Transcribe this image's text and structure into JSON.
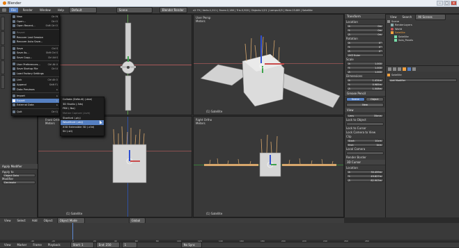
{
  "window": {
    "title": "Blender"
  },
  "infobar": {
    "menus": [
      "File",
      "Render",
      "Window",
      "Help"
    ],
    "layout": "Default",
    "scene": "Scene",
    "engine": "Blender Render",
    "stats": "v2.79 | Verts:1,211 | Faces:2,180 | Tris:3,920 | Objects:1/21 | Lamps:0/0 | Mem:23.8M | Satellite"
  },
  "file_menu": {
    "items": [
      {
        "label": "New",
        "shortcut": "Ctrl N",
        "icon": "new-file-icon",
        "state": "normal"
      },
      {
        "label": "Open...",
        "shortcut": "Ctrl O",
        "icon": "folder-open-icon",
        "state": "normal"
      },
      {
        "label": "Open Recent...",
        "shortcut": "Shift Ctrl O",
        "icon": "recent-icon",
        "state": "normal"
      },
      {
        "label": "Revert",
        "shortcut": "",
        "icon": "revert-icon",
        "state": "dim"
      },
      {
        "label": "Recover Last Session",
        "shortcut": "",
        "icon": "recover-icon",
        "state": "normal"
      },
      {
        "label": "Recover Auto Save...",
        "shortcut": "",
        "icon": "recover-auto-icon",
        "state": "normal"
      },
      {
        "label": "Save",
        "shortcut": "Ctrl S",
        "icon": "save-icon",
        "state": "normal"
      },
      {
        "label": "Save As...",
        "shortcut": "Shift Ctrl S",
        "icon": "save-as-icon",
        "state": "normal"
      },
      {
        "label": "Save Copy...",
        "shortcut": "Ctrl Alt S",
        "icon": "save-copy-icon",
        "state": "normal"
      },
      {
        "label": "User Preferences...",
        "shortcut": "Ctrl Alt U",
        "icon": "preferences-icon",
        "state": "normal"
      },
      {
        "label": "Save Startup File",
        "shortcut": "Ctrl U",
        "icon": "save-startup-icon",
        "state": "normal"
      },
      {
        "label": "Load Factory Settings",
        "shortcut": "",
        "icon": "factory-icon",
        "state": "normal"
      },
      {
        "label": "Link",
        "shortcut": "Ctrl Alt O",
        "icon": "link-icon",
        "state": "normal"
      },
      {
        "label": "Append",
        "shortcut": "Shift F1",
        "icon": "append-icon",
        "state": "normal"
      },
      {
        "label": "Data Previews",
        "shortcut": "▸",
        "icon": "previews-icon",
        "state": "normal"
      },
      {
        "label": "Import",
        "shortcut": "▸",
        "icon": "import-icon",
        "state": "normal"
      },
      {
        "label": "Export",
        "shortcut": "▸",
        "icon": "export-icon",
        "state": "selected"
      },
      {
        "label": "External Data",
        "shortcut": "▸",
        "icon": "external-icon",
        "state": "normal"
      },
      {
        "label": "Quit",
        "shortcut": "Ctrl Q",
        "icon": "quit-icon",
        "state": "normal"
      }
    ]
  },
  "export_menu": {
    "items": [
      {
        "label": "Collada (Default) (.dae)",
        "state": "normal"
      },
      {
        "label": "3D Studio (.3ds)",
        "state": "normal"
      },
      {
        "label": "FBX (.fbx)",
        "state": "normal"
      },
      {
        "label": "Motion Capture (.bvh)",
        "state": "dim"
      },
      {
        "label": "Stanford (.ply)",
        "state": "normal"
      },
      {
        "label": "Wavefront (.obj)",
        "state": "selected"
      },
      {
        "label": "X3D Extensible 3D (.x3d)",
        "state": "normal"
      },
      {
        "label": "Stl (.stl)",
        "state": "normal"
      }
    ]
  },
  "viewports": {
    "top_left": {
      "label": "",
      "object": "(1) Satellite"
    },
    "top_right": {
      "label": "User Persp",
      "units": "Meters",
      "object": "(1) Satellite"
    },
    "bottom_left": {
      "label": "Front Ortho",
      "units": "Meters",
      "object": "(1) Satellite"
    },
    "bottom_right": {
      "label": "Right Ortho",
      "units": "Meters",
      "object": "(1) Satellite"
    }
  },
  "tool_panel": {
    "title": "Apply Modifier",
    "apply_to_label": "Apply to",
    "apply_to": "Object Data",
    "modifier_label": "Modifier",
    "modifier": "Decimate"
  },
  "n_panel": {
    "transform_title": "Transform",
    "location_label": "Location",
    "location": [
      "0m",
      "0m",
      "0m"
    ],
    "rotation_label": "Rotation",
    "rotation": [
      "0°",
      "0°",
      "0°"
    ],
    "rotation_mode": "XYZ Euler",
    "scale_label": "Scale",
    "scale": [
      "1.000",
      "1.000",
      "1.000"
    ],
    "dimensions_label": "Dimensions",
    "dimensions": [
      "1.434m",
      "0.985m",
      "1.508m"
    ],
    "grease_title": "Grease Pencil",
    "grease_tabs": [
      "Scene",
      "Object"
    ],
    "grease_new": "New",
    "view_title": "View",
    "lens_label": "Lens",
    "lens": "35mm",
    "lock_label": "Lock to Object",
    "lock_cursor": "Lock to Cursor",
    "lock_camera": "Lock Camera to View",
    "clip_label": "Clip",
    "clip_start": "10cm",
    "clip_end": "1km",
    "local_camera": "Local Camera",
    "render_border": "Render Border",
    "cursor_title": "3D Cursor",
    "cursor_location_label": "Location",
    "cursor_location": [
      "30.459m",
      "49.827m",
      "82.903m"
    ]
  },
  "outliner": {
    "tabs": [
      "View",
      "Search",
      "All Scenes"
    ],
    "rows": [
      "Scene",
      "RenderLayers",
      "World",
      "Satellite",
      "Satellite",
      "Sola_Panels"
    ]
  },
  "properties": {
    "object": "Satellite",
    "add_modifier": "Add Modifier"
  },
  "viewport_header": {
    "menus": [
      "View",
      "Select",
      "Add",
      "Object"
    ],
    "mode": "Object Mode",
    "pivot": "Global"
  },
  "timeline": {
    "menus": [
      "View",
      "Marker",
      "Frame",
      "Playback"
    ],
    "start": "Start: 1",
    "end": "End: 250",
    "current": "1",
    "sync": "No Sync",
    "ticks": [
      "-40",
      "-20",
      "0",
      "20",
      "40",
      "60",
      "80",
      "100",
      "120",
      "140",
      "160",
      "180",
      "200",
      "220",
      "240",
      "260",
      "280"
    ]
  },
  "colors": {
    "accent": "#5680c2",
    "bg": "#393939",
    "blender_orange": "#e87d0d"
  }
}
